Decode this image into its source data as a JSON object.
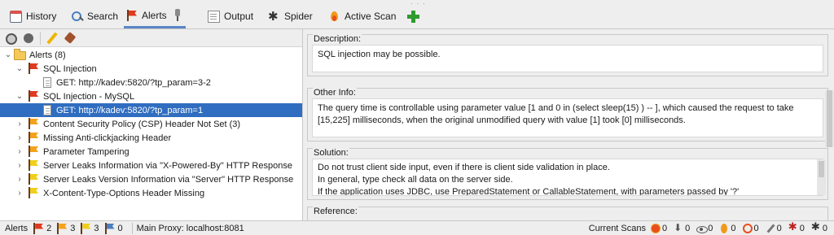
{
  "tabs": [
    {
      "label": "History",
      "icon": "history-icon"
    },
    {
      "label": "Search",
      "icon": "search-icon"
    },
    {
      "label": "Alerts",
      "icon": "alert-flag-icon",
      "active": true
    },
    {
      "label": "Output",
      "icon": "output-icon"
    },
    {
      "label": "Spider",
      "icon": "spider-icon"
    },
    {
      "label": "Active Scan",
      "icon": "flame-icon"
    }
  ],
  "tree": {
    "root": "Alerts (8)",
    "items": [
      {
        "label": "SQL Injection",
        "flag_color": "#e03a1f"
      },
      {
        "label": "GET: http://kadev:5820/?tp_param=3-2"
      },
      {
        "label": "SQL Injection - MySQL",
        "flag_color": "#e03a1f"
      },
      {
        "label": "GET: http://kadev:5820/?tp_param=1",
        "selected": true
      },
      {
        "label": "Content Security Policy (CSP) Header Not Set (3)",
        "flag_color": "#f4a21c"
      },
      {
        "label": "Missing Anti-clickjacking Header",
        "flag_color": "#f4a21c"
      },
      {
        "label": "Parameter Tampering",
        "flag_color": "#f4a21c"
      },
      {
        "label": "Server Leaks Information via \"X-Powered-By\" HTTP Response",
        "flag_color": "#f0cf1c"
      },
      {
        "label": "Server Leaks Version Information via \"Server\" HTTP Response",
        "flag_color": "#f0cf1c"
      },
      {
        "label": "X-Content-Type-Options Header Missing",
        "flag_color": "#f0cf1c"
      }
    ]
  },
  "details": {
    "description_label": "Description:",
    "description": "SQL injection may be possible.",
    "other_info_label": "Other Info:",
    "other_info_line1": "The query time is controllable using parameter value [1 and 0 in (select sleep(15) ) -- ], which caused the request to take",
    "other_info_line2": "[15,225] milliseconds, when the original unmodified query with value [1] took [0] milliseconds.",
    "solution_label": "Solution:",
    "solution_line1": "Do not trust client side input, even if there is client side validation in place.",
    "solution_line2": "In general, type check all data on the server side.",
    "solution_line3": "If the application uses JDBC, use PreparedStatement or CallableStatement, with parameters passed by '?'",
    "reference_label": "Reference:"
  },
  "status": {
    "alerts_label": "Alerts",
    "high": "2",
    "medium": "3",
    "low": "3",
    "info": "0",
    "proxy": "Main Proxy: localhost:8081",
    "current_scans_label": "Current Scans",
    "scan_counts": [
      "0",
      "0",
      "0",
      "0",
      "0",
      "0",
      "0",
      "0"
    ],
    "colors": {
      "high": "#e03a1f",
      "medium": "#f4a21c",
      "low": "#f0cf1c",
      "info": "#4a7fc0",
      "selection": "#2f6dc0"
    }
  }
}
